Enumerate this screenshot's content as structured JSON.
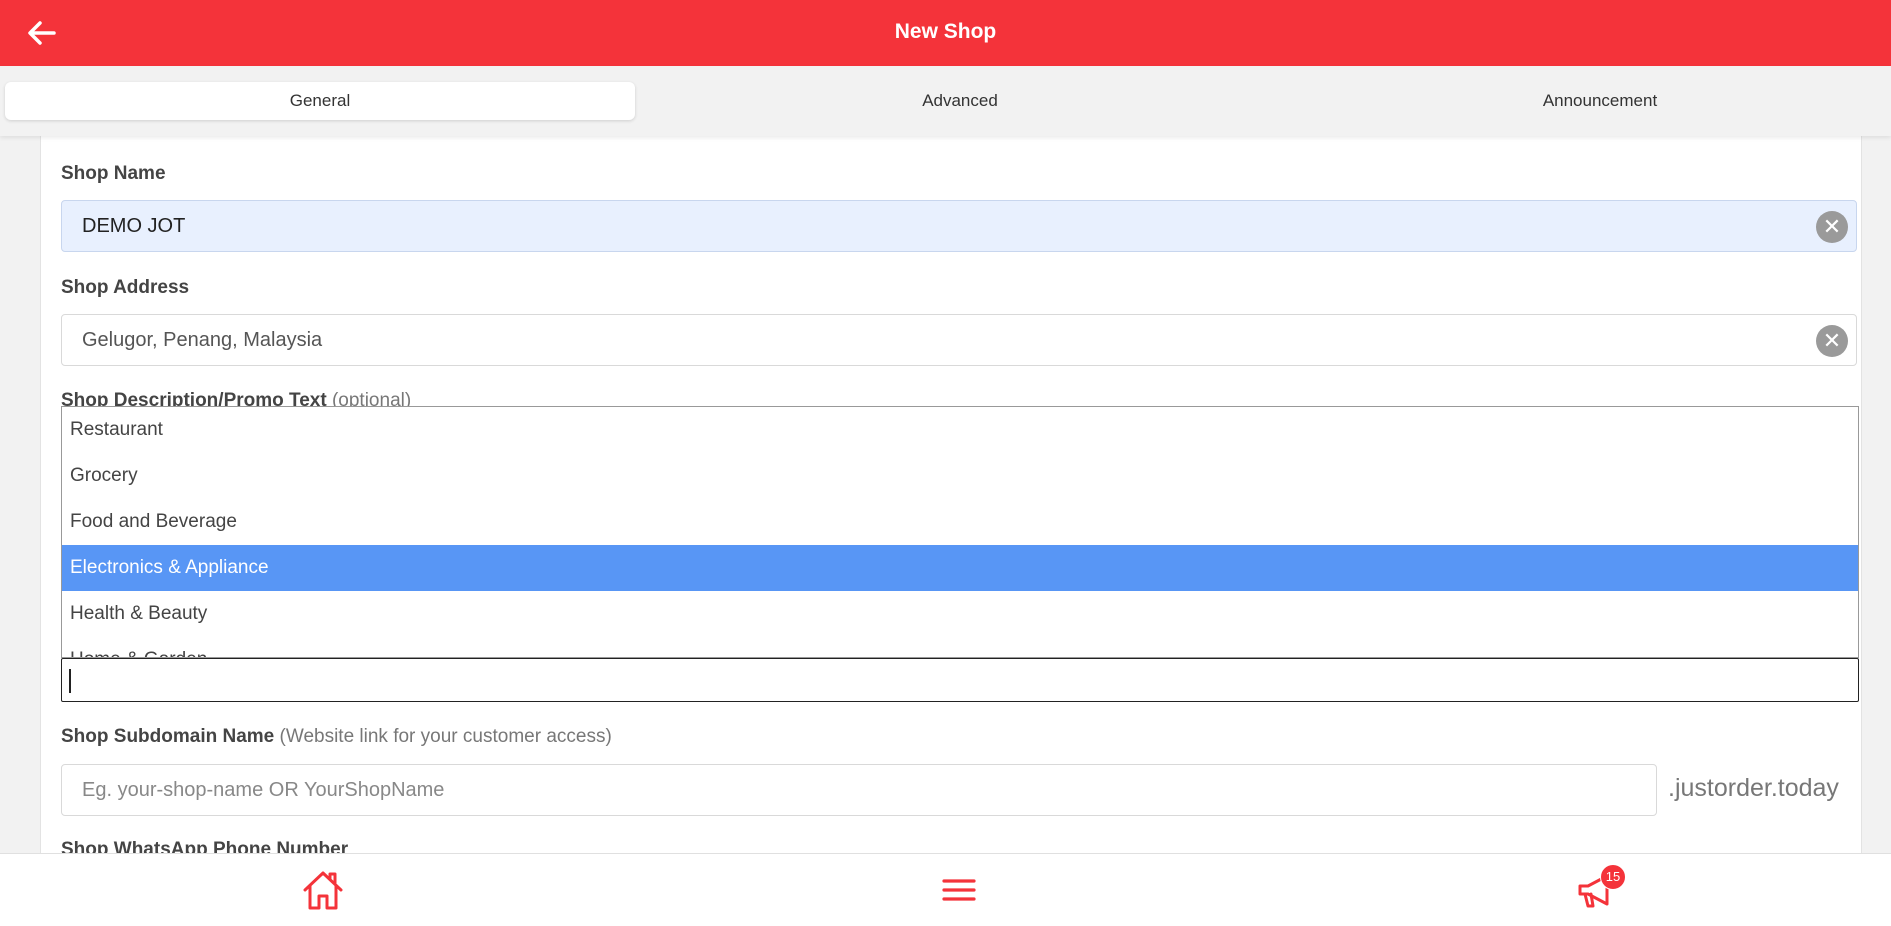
{
  "header": {
    "title": "New Shop",
    "back_icon": "arrow-left-icon"
  },
  "tabs": [
    {
      "label": "General",
      "active": true
    },
    {
      "label": "Advanced",
      "active": false
    },
    {
      "label": "Announcement",
      "active": false
    }
  ],
  "form": {
    "shop_name": {
      "label": "Shop Name",
      "value": "DEMO JOT"
    },
    "shop_address": {
      "label": "Shop Address",
      "value": "Gelugor, Penang, Malaysia"
    },
    "shop_description": {
      "label": "Shop Description/Promo Text",
      "hint": "(optional)"
    },
    "category_dropdown": {
      "options": [
        "Restaurant",
        "Grocery",
        "Food and Beverage",
        "Electronics & Appliance",
        "Health & Beauty",
        "Home & Garden"
      ],
      "selected": "Electronics & Appliance",
      "search_value": ""
    },
    "subdomain": {
      "label": "Shop Subdomain Name",
      "hint": "(Website link for your customer access)",
      "placeholder": "Eg. your-shop-name OR YourShopName",
      "suffix": ".justorder.today"
    },
    "whatsapp": {
      "label": "Shop WhatsApp Phone Number"
    }
  },
  "bottom_nav": {
    "home_icon": "home-icon",
    "menu_icon": "menu-icon",
    "announce_icon": "megaphone-icon",
    "badge_count": "15"
  },
  "colors": {
    "brand": "#f4333a",
    "selected_option": "#5896f5",
    "filled_input": "#e8f0fe"
  }
}
